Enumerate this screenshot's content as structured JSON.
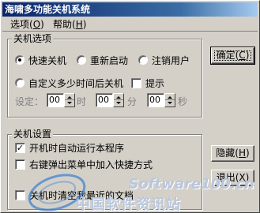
{
  "window": {
    "title": "海啸多功能关机系统"
  },
  "menu": [
    {
      "label": "选项(",
      "key": "O",
      "suffix": ")"
    },
    {
      "label": "帮助(",
      "key": "H",
      "suffix": ")"
    }
  ],
  "shutdown_options": {
    "title": "关机选项",
    "radios": [
      {
        "label": "快速关机",
        "checked": true
      },
      {
        "label": "重新启动",
        "checked": false
      },
      {
        "label": "注销用户",
        "checked": false
      },
      {
        "label": "自定义多少时间后关机",
        "checked": false
      }
    ],
    "prompt_checkbox": {
      "label": "提示",
      "checked": false
    },
    "set_label": "设定：",
    "hours_value": "00",
    "hours_unit": "时",
    "minutes_value": "00",
    "minutes_unit": "分",
    "seconds_value": "00",
    "seconds_unit": "秒"
  },
  "shutdown_settings": {
    "title": "关机设置",
    "checkboxes": [
      {
        "label": "开机时自动运行本程序",
        "checked": true
      },
      {
        "label": "右键弹出菜单中加入快捷方式",
        "checked": false
      },
      {
        "label": "关机时清空我最近的文档",
        "checked": false
      }
    ]
  },
  "buttons": {
    "confirm": {
      "label": "确定(",
      "key": "C",
      "suffix": ")"
    },
    "hide": {
      "label": "隐藏(",
      "key": "H",
      "suffix": ")"
    },
    "exit": {
      "label": "退出(",
      "key": "X",
      "suffix": ")"
    }
  },
  "watermark": {
    "brand": "Software100.cn",
    "cn_text": "中国软件资讯站"
  },
  "colors": {
    "titlebar_start": "#0a246a",
    "titlebar_end": "#a6caf0",
    "face": "#d4d0c8"
  }
}
